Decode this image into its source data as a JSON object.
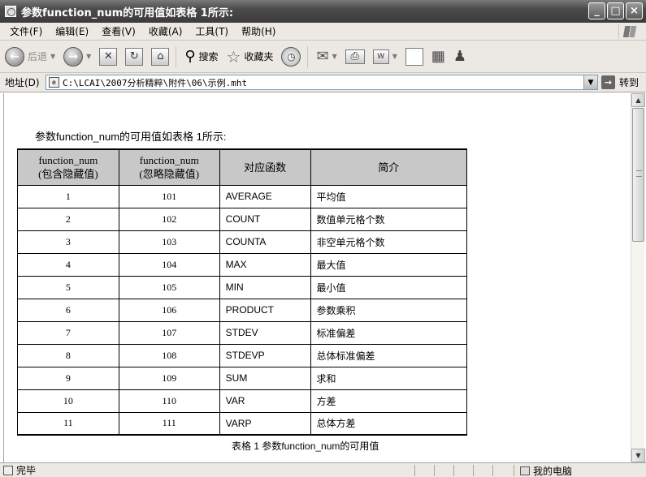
{
  "window": {
    "title": "参数function_num的可用值如表格  1所示:",
    "btn_minimize": "_",
    "btn_maximize": "□",
    "btn_close": "×"
  },
  "menu": {
    "items": [
      "文件(F)",
      "编辑(E)",
      "查看(V)",
      "收藏(A)",
      "工具(T)",
      "帮助(H)"
    ]
  },
  "toolbar": {
    "back_label": "后退",
    "search_label": "搜索",
    "favorites_label": "收藏夹"
  },
  "address": {
    "label": "地址(D)",
    "value": "C:\\LCAI\\2007分析精粹\\附件\\06\\示例.mht",
    "go_label": "转到"
  },
  "document": {
    "heading": "参数function_num的可用值如表格  1所示:",
    "table_headers": [
      {
        "line1": "function_num",
        "line2": "(包含隐藏值)"
      },
      {
        "line1": "function_num",
        "line2": "(忽略隐藏值)"
      },
      {
        "line1": "对应函数",
        "line2": ""
      },
      {
        "line1": "简介",
        "line2": ""
      }
    ],
    "rows": [
      {
        "a": "1",
        "b": "101",
        "fn": "AVERAGE",
        "desc": "平均值"
      },
      {
        "a": "2",
        "b": "102",
        "fn": "COUNT",
        "desc": "数值单元格个数"
      },
      {
        "a": "3",
        "b": "103",
        "fn": "COUNTA",
        "desc": "非空单元格个数"
      },
      {
        "a": "4",
        "b": "104",
        "fn": "MAX",
        "desc": "最大值"
      },
      {
        "a": "5",
        "b": "105",
        "fn": "MIN",
        "desc": "最小值"
      },
      {
        "a": "6",
        "b": "106",
        "fn": "PRODUCT",
        "desc": "参数乘积"
      },
      {
        "a": "7",
        "b": "107",
        "fn": "STDEV",
        "desc": "标准偏差"
      },
      {
        "a": "8",
        "b": "108",
        "fn": "STDEVP",
        "desc": "总体标准偏差"
      },
      {
        "a": "9",
        "b": "109",
        "fn": "SUM",
        "desc": "求和"
      },
      {
        "a": "10",
        "b": "110",
        "fn": "VAR",
        "desc": "方差"
      },
      {
        "a": "11",
        "b": "111",
        "fn": "VARP",
        "desc": "总体方差"
      }
    ],
    "caption": "表格  1    参数function_num的可用值"
  },
  "status": {
    "text": "完毕",
    "zone": "我的电脑"
  }
}
